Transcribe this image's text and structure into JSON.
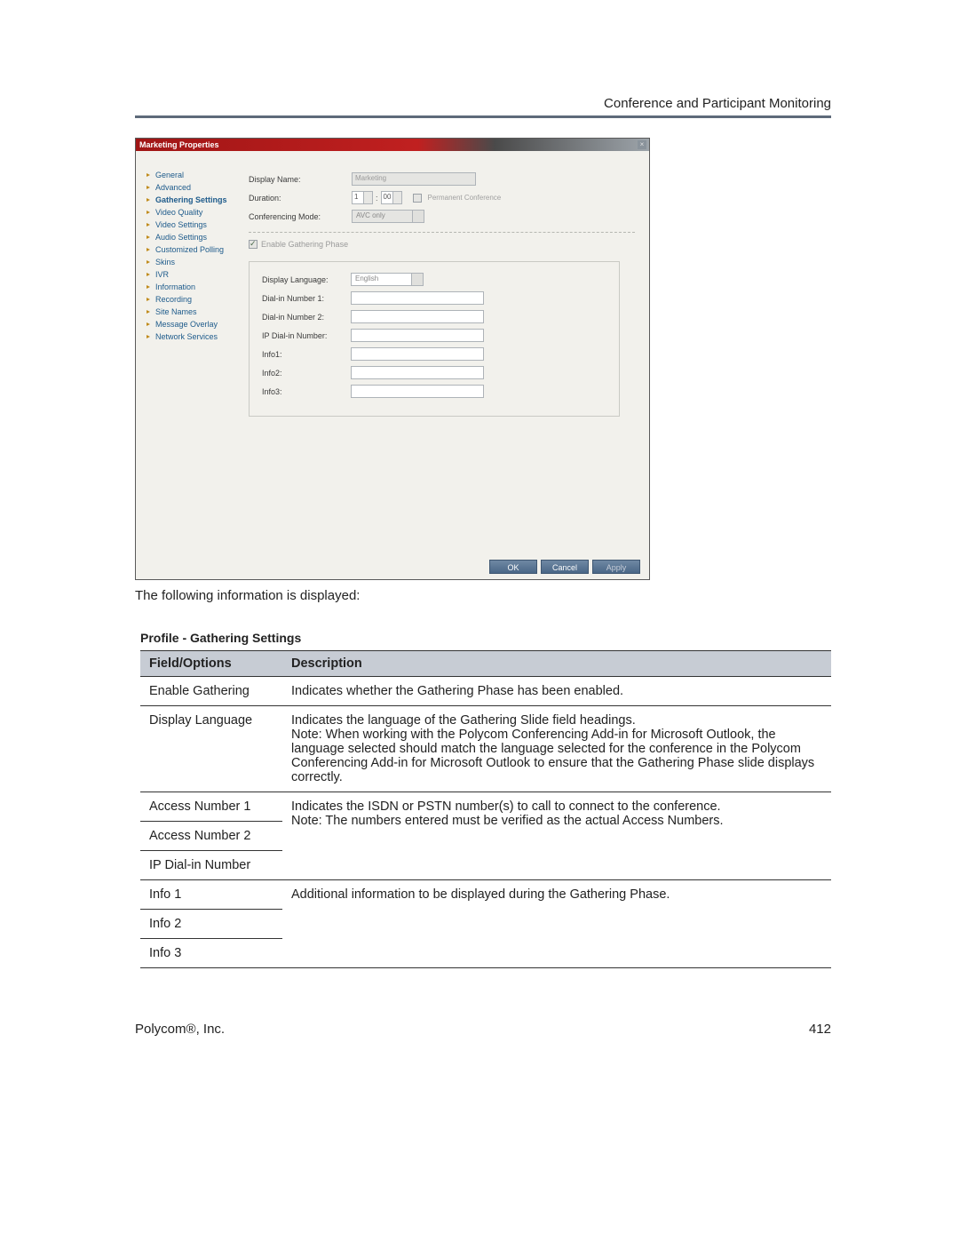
{
  "header": {
    "text": "Conference and Participant Monitoring"
  },
  "dialog": {
    "title": "Marketing Properties",
    "nav": [
      "General",
      "Advanced",
      "Gathering Settings",
      "Video Quality",
      "Video Settings",
      "Audio Settings",
      "Customized Polling",
      "Skins",
      "IVR",
      "Information",
      "Recording",
      "Site Names",
      "Message Overlay",
      "Network Services"
    ],
    "nav_selected_index": 2,
    "labels": {
      "display_name": "Display Name:",
      "duration": "Duration:",
      "conf_mode": "Conferencing Mode:",
      "enable_gathering": "Enable Gathering Phase",
      "display_language": "Display Language:",
      "dialin1": "Dial-in Number 1:",
      "dialin2": "Dial-in Number 2:",
      "ipdial": "IP Dial-in Number:",
      "info1": "Info1:",
      "info2": "Info2:",
      "info3": "Info3:"
    },
    "values": {
      "display_name": "Marketing",
      "duration_hours": "1",
      "duration_mins": "00",
      "permanent_conf": "Permanent Conference",
      "conf_mode": "AVC only",
      "display_language": "English"
    },
    "buttons": {
      "ok": "OK",
      "cancel": "Cancel",
      "apply": "Apply"
    }
  },
  "caption": "The following information is displayed:",
  "table": {
    "title": "Profile - Gathering Settings",
    "headers": {
      "field": "Field/Options",
      "desc": "Description"
    },
    "rows": {
      "enable_gathering": "Enable Gathering",
      "enable_gathering_desc": "Indicates whether the Gathering Phase has been enabled.",
      "display_language": "Display Language",
      "display_language_desc": "Indicates the language of the Gathering Slide field headings.\nNote: When working with the Polycom Conferencing Add-in for Microsoft Outlook, the language selected should match the language selected for the conference in the Polycom Conferencing Add-in for Microsoft Outlook to ensure that the Gathering Phase slide displays correctly.",
      "access1": "Access Number 1",
      "access2": "Access Number 2",
      "ipdial": "IP Dial-in Number",
      "access_desc": "Indicates the ISDN or PSTN number(s) to call to connect to the conference.\nNote: The numbers entered must be verified as the actual Access Numbers.",
      "info1": "Info 1",
      "info2": "Info 2",
      "info3": "Info 3",
      "info_desc": "Additional information to be displayed during the Gathering Phase."
    }
  },
  "footer": {
    "left": "Polycom®, Inc.",
    "right": "412"
  }
}
